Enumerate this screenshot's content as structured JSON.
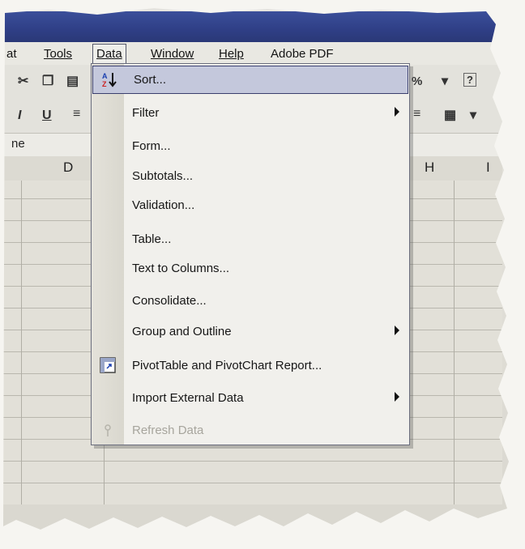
{
  "menubar": {
    "items": [
      {
        "label": "at"
      },
      {
        "label": "Tools"
      },
      {
        "label": "Data"
      },
      {
        "label": "Window"
      },
      {
        "label": "Help"
      },
      {
        "label": "Adobe PDF"
      }
    ]
  },
  "toolbar": {
    "zoom_suffix": "%",
    "font_labels": {
      "italic": "I",
      "underline": "U"
    }
  },
  "formula_bar": {
    "namebox_text": "ne"
  },
  "columns": {
    "d": "D",
    "h": "H",
    "i": "I"
  },
  "dropdown": {
    "items": [
      {
        "label": "Sort...",
        "icon": "sort-ascending-icon",
        "highlighted": true
      },
      {
        "label": "Filter",
        "submenu": true
      },
      {
        "label": "Form..."
      },
      {
        "label": "Subtotals..."
      },
      {
        "label": "Validation..."
      },
      {
        "label": "Table..."
      },
      {
        "label": "Text to Columns..."
      },
      {
        "label": "Consolidate..."
      },
      {
        "label": "Group and Outline",
        "submenu": true
      },
      {
        "label": "PivotTable and PivotChart Report...",
        "icon": "pivot-table-icon"
      },
      {
        "label": "Import External Data",
        "submenu": true
      },
      {
        "label": "Refresh Data",
        "icon": "refresh-icon",
        "disabled": true
      }
    ]
  },
  "colors": {
    "titlebar": "#2f3f86",
    "menu_highlight": "#c4c8dc",
    "menu_border": "#3a3f6e"
  }
}
